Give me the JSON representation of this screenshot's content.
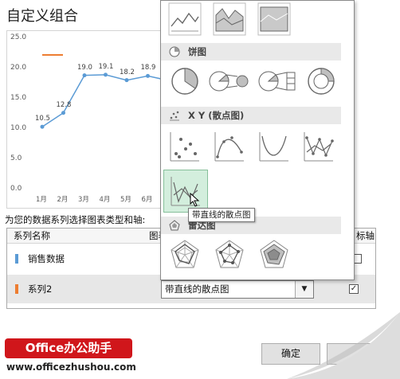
{
  "dialog": {
    "title": "自定义组合"
  },
  "chart": {
    "y_ticks": [
      "25.0",
      "20.0",
      "15.0",
      "10.0",
      "5.0",
      "0.0"
    ],
    "x_ticks": [
      "1月",
      "2月",
      "3月",
      "4月",
      "5月",
      "6月"
    ],
    "points": [
      {
        "label": "10.5",
        "value": 10.5
      },
      {
        "label": "12.8",
        "value": 12.8
      },
      {
        "label": "19.0",
        "value": 19.0
      },
      {
        "label": "19.1",
        "value": 19.1
      },
      {
        "label": "18.2",
        "value": 18.2
      },
      {
        "label": "18.9",
        "value": 18.9
      }
    ],
    "ylim": [
      0,
      25
    ],
    "line_color": "#5b9bd5",
    "legend_color": "#ed7d31"
  },
  "section_label": "为您的数据系列选择图表类型和轴:",
  "table": {
    "headers": {
      "name": "系列名称",
      "type": "图表",
      "axis": "标轴"
    },
    "rows": [
      {
        "name": "销售数据",
        "color": "#5b9bd5"
      },
      {
        "name": "系列2",
        "color": "#ed7d31",
        "chart_type": "带直线的散点图",
        "secondary_axis": "✓"
      }
    ]
  },
  "dropdown": {
    "categories": [
      {
        "name": "饼图"
      },
      {
        "name": "X Y (散点图)"
      },
      {
        "name": "雷达图"
      }
    ]
  },
  "tooltip": "带直线的散点图",
  "buttons": {
    "ok": "确定"
  },
  "brand": {
    "name": "Office办公助手",
    "url": "www.officezhushou.com"
  }
}
